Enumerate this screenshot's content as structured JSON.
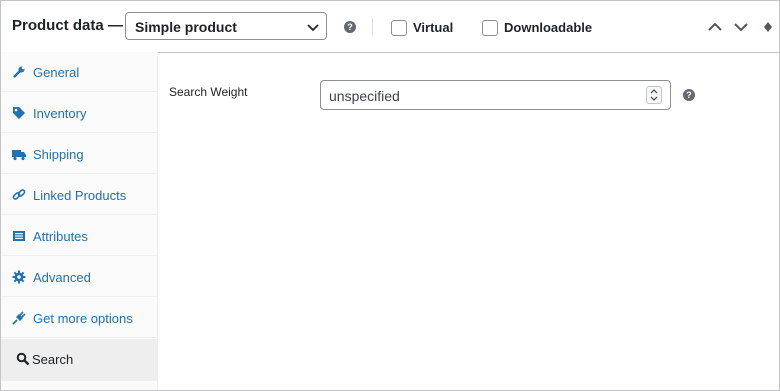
{
  "header": {
    "title": "Product data —",
    "product_type": "Simple product",
    "help_glyph": "?",
    "virtual_label": "Virtual",
    "downloadable_label": "Downloadable",
    "virtual_checked": false,
    "downloadable_checked": false
  },
  "sidebar": {
    "items": [
      {
        "label": "General",
        "icon": "wrench-icon"
      },
      {
        "label": "Inventory",
        "icon": "tag-icon"
      },
      {
        "label": "Shipping",
        "icon": "truck-icon"
      },
      {
        "label": "Linked Products",
        "icon": "link-icon"
      },
      {
        "label": "Attributes",
        "icon": "list-icon"
      },
      {
        "label": "Advanced",
        "icon": "gear-icon"
      },
      {
        "label": "Get more options",
        "icon": "plugin-icon"
      },
      {
        "label": "Search",
        "icon": "search-icon",
        "active": true
      }
    ]
  },
  "main": {
    "search_weight_label": "Search Weight",
    "search_weight_value": "unspecified",
    "help_glyph": "?"
  },
  "colors": {
    "link": "#2271b1",
    "text": "#1d2327",
    "border": "#c3c4c7",
    "active_tab_bg": "#eeeeee",
    "sidebar_bg": "#fafafa"
  }
}
